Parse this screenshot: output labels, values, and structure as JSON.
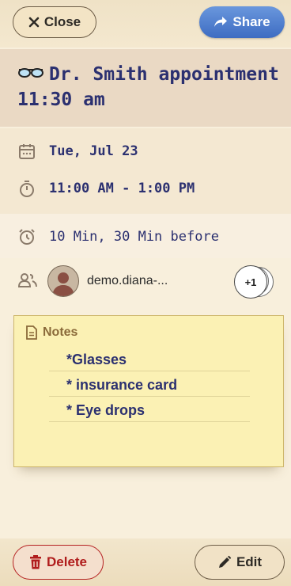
{
  "header": {
    "close_label": "Close",
    "share_label": "Share"
  },
  "event": {
    "title": "Dr. Smith appointment 11:30 am",
    "date": "Tue, Jul 23",
    "time": "11:00 AM - 1:00 PM",
    "reminder": "10 Min, 30 Min before"
  },
  "attendees": {
    "primary": "demo.diana-...",
    "more_count": "+1"
  },
  "notes": {
    "heading": "Notes",
    "items": [
      "*Glasses",
      "* insurance card",
      "* Eye drops"
    ]
  },
  "footer": {
    "delete_label": "Delete",
    "edit_label": "Edit"
  },
  "colors": {
    "accent_blue": "#3d6cc2",
    "title_text": "#2b3070",
    "delete_red": "#b01c1c",
    "notes_bg": "#fbf1b4"
  }
}
